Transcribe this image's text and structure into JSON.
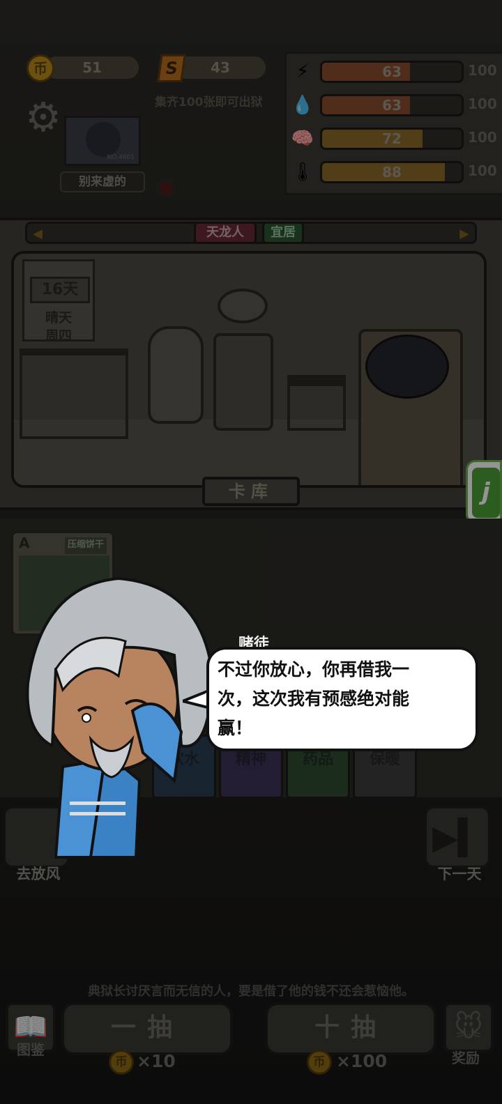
{
  "resources": {
    "coin_icon_text": "币",
    "coin_value": "51",
    "ticket_icon_text": "S",
    "ticket_value": "43",
    "collect_hint": "集齐100张即可出狱"
  },
  "stats": [
    {
      "icon": "lightning-icon",
      "glyph": "⚡",
      "value": 63,
      "max": "100",
      "fill_fraction": 0.63,
      "color": "#8a4f2f"
    },
    {
      "icon": "water-drop-icon",
      "glyph": "💧",
      "value": 63,
      "max": "100",
      "fill_fraction": 0.63,
      "color": "#8a4f2f"
    },
    {
      "icon": "brain-icon",
      "glyph": "🧠",
      "value": 72,
      "max": "100",
      "fill_fraction": 0.72,
      "color": "#8c6a2a"
    },
    {
      "icon": "thermometer-icon",
      "glyph": "🌡",
      "value": 88,
      "max": "100",
      "fill_fraction": 0.88,
      "color": "#8c6a2a"
    }
  ],
  "player": {
    "avatar_tag": "NO.4601",
    "name": "别来虚的"
  },
  "cell": {
    "tag_1": "天龙人",
    "tag_2": "宜居",
    "day": "16天",
    "weather": "晴天",
    "weekday": "周四",
    "library_button": "卡库"
  },
  "card": {
    "rank": "A",
    "name": "压缩饼干"
  },
  "slots": [
    {
      "label": "饮水",
      "color": "#2b3f55"
    },
    {
      "label": "精神",
      "color": "#3b3358"
    },
    {
      "label": "药品",
      "color": "#2f4c32"
    },
    {
      "label": "保暖",
      "color": "#3d3d3d"
    }
  ],
  "dialogue": {
    "speaker": "赌徒",
    "text_line_1": "不过你放心，你再借我一",
    "text_line_2": "次，这次我有预感绝对能",
    "text_line_3": "赢！"
  },
  "actions": {
    "go_out": "去放风",
    "next_day": "下一天",
    "footer_hint": "典狱长讨厌言而无信的人，要是借了他的钱不还会惹恼他。",
    "draw_one": "一抽",
    "draw_one_cost": "×10",
    "draw_ten": "十抽",
    "draw_ten_cost": "×100",
    "coin_icon_text": "币",
    "catalog": "图鉴",
    "reward": "奖励"
  },
  "accent_colors": {
    "bubble_bg": "#ffffff",
    "prison_uniform": "#3b82c4",
    "badge_green": "#4e9f39"
  }
}
